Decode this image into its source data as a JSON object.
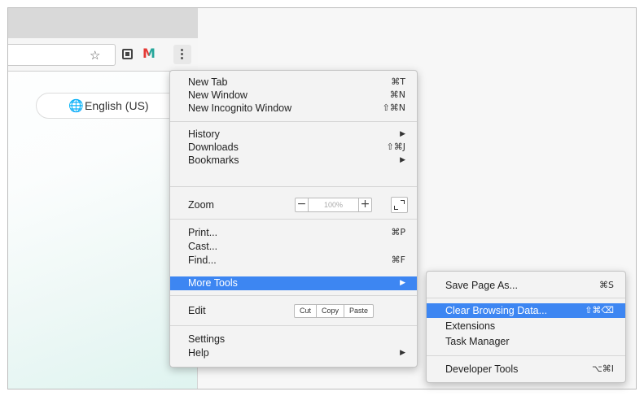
{
  "browser": {
    "toolbar_icons": [
      "star-icon",
      "extension-icon",
      "m-extension-icon",
      "kebab-menu-icon"
    ],
    "language_button": "English (US)",
    "globe_glyph": "🌐"
  },
  "menu": {
    "new_tab": {
      "label": "New Tab",
      "shortcut": "⌘T"
    },
    "new_window": {
      "label": "New Window",
      "shortcut": "⌘N"
    },
    "new_incognito": {
      "label": "New Incognito Window",
      "shortcut": "⇧⌘N"
    },
    "history": {
      "label": "History",
      "arrow": "▶"
    },
    "downloads": {
      "label": "Downloads",
      "shortcut": "⇧⌘J"
    },
    "bookmarks": {
      "label": "Bookmarks",
      "arrow": "▶"
    },
    "zoom": {
      "label": "Zoom",
      "minus": "−",
      "value": "100%",
      "plus": "+"
    },
    "print": {
      "label": "Print...",
      "shortcut": "⌘P"
    },
    "cast": {
      "label": "Cast..."
    },
    "find": {
      "label": "Find...",
      "shortcut": "⌘F"
    },
    "more_tools": {
      "label": "More Tools",
      "arrow": "▶"
    },
    "edit": {
      "label": "Edit",
      "cut": "Cut",
      "copy": "Copy",
      "paste": "Paste"
    },
    "settings": {
      "label": "Settings"
    },
    "help": {
      "label": "Help",
      "arrow": "▶"
    }
  },
  "submenu": {
    "save_page": {
      "label": "Save Page As...",
      "shortcut": "⌘S"
    },
    "clear_data": {
      "label": "Clear Browsing Data...",
      "shortcut": "⇧⌘⌫"
    },
    "extensions": {
      "label": "Extensions"
    },
    "task_manager": {
      "label": "Task Manager"
    },
    "dev_tools": {
      "label": "Developer Tools",
      "shortcut": "⌥⌘I"
    }
  },
  "colors": {
    "highlight": "#3d86f2",
    "menu_bg": "#f3f3f3"
  }
}
